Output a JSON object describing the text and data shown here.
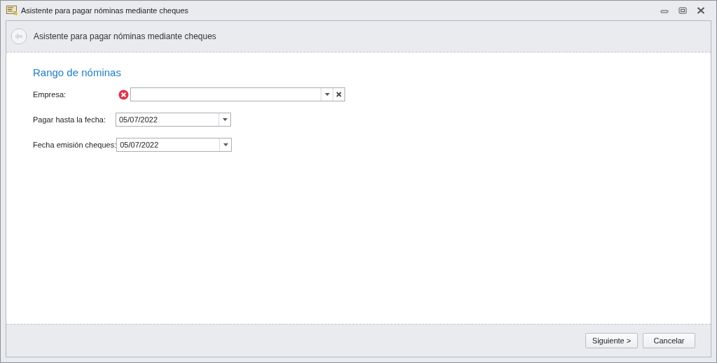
{
  "window": {
    "title": "Asistente para pagar nóminas mediante cheques"
  },
  "header": {
    "title": "Asistente para pagar nóminas mediante cheques"
  },
  "section_title": "Rango de nóminas",
  "fields": [
    {
      "kind": "combo",
      "label": "Empresa:",
      "error": true
    },
    {
      "kind": "date",
      "label": "Pagar hasta la fecha:",
      "value": "05/07/2022",
      "error": false
    },
    {
      "kind": "date",
      "label": "Fecha emisión cheques:",
      "value": "05/07/2022",
      "error": false
    }
  ],
  "buttons": [
    "Siguiente >",
    "Cancelar"
  ]
}
